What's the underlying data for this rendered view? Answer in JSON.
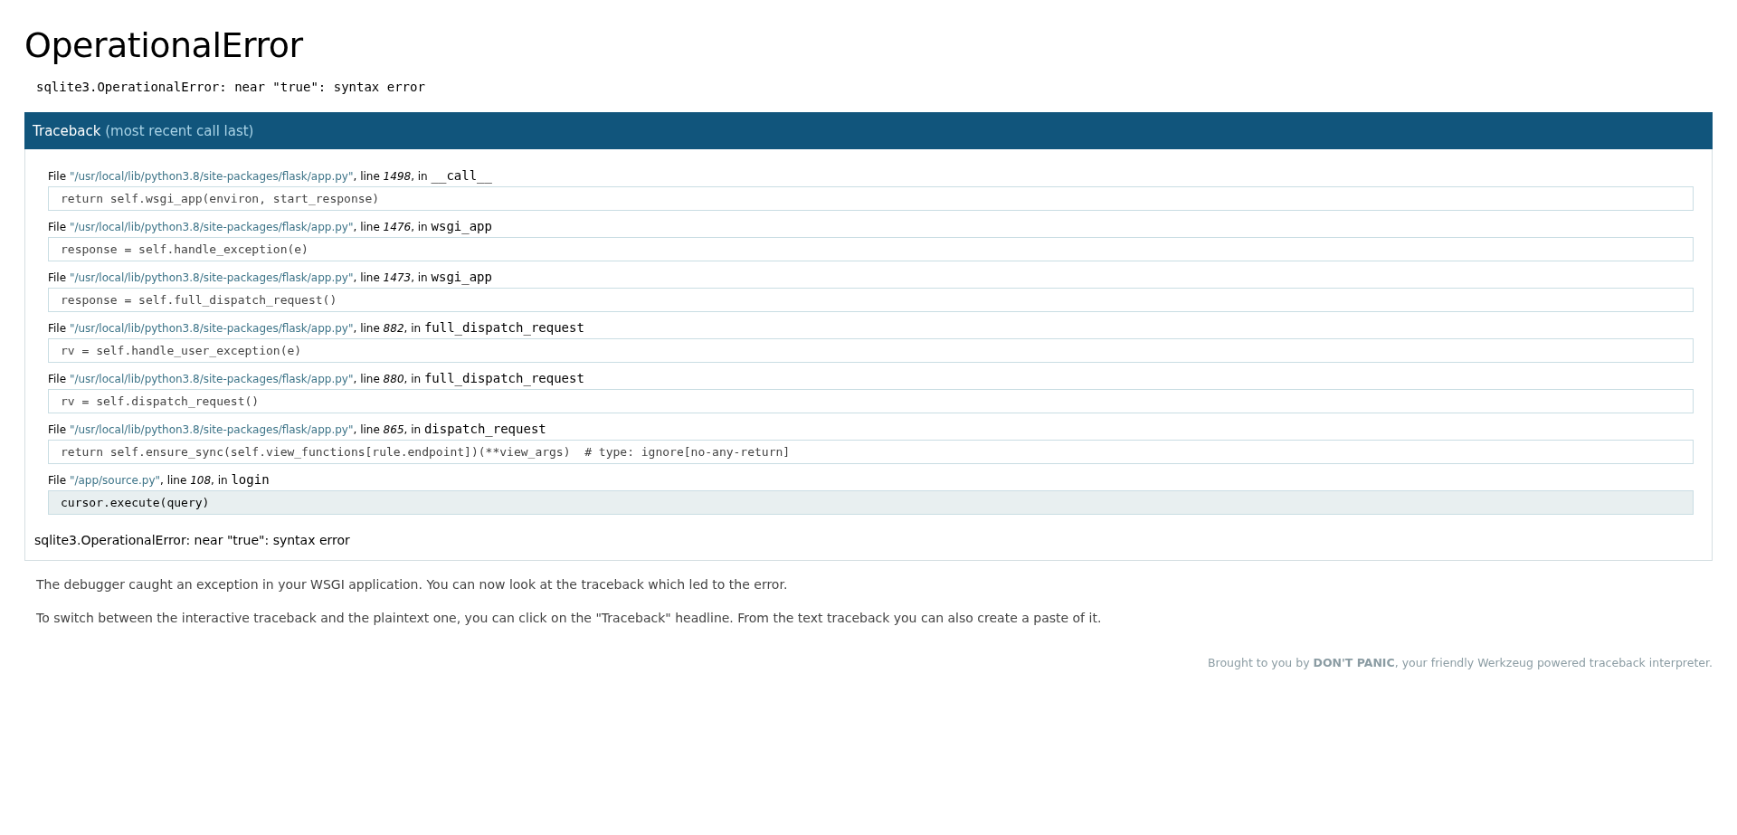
{
  "title": "OperationalError",
  "error_summary": "sqlite3.OperationalError: near \"true\": syntax error",
  "traceback": {
    "heading": "Traceback",
    "heading_note": "(most recent call last)",
    "frames": [
      {
        "file_label": "File ",
        "path": "\"/usr/local/lib/python3.8/site-packages/flask/app.py\"",
        "line_label": ", line ",
        "line": "1498",
        "in_label": ", in ",
        "function": "__call__",
        "code": "return self.wsgi_app(environ, start_response)",
        "current": false
      },
      {
        "file_label": "File ",
        "path": "\"/usr/local/lib/python3.8/site-packages/flask/app.py\"",
        "line_label": ", line ",
        "line": "1476",
        "in_label": ", in ",
        "function": "wsgi_app",
        "code": "response = self.handle_exception(e)",
        "current": false
      },
      {
        "file_label": "File ",
        "path": "\"/usr/local/lib/python3.8/site-packages/flask/app.py\"",
        "line_label": ", line ",
        "line": "1473",
        "in_label": ", in ",
        "function": "wsgi_app",
        "code": "response = self.full_dispatch_request()",
        "current": false
      },
      {
        "file_label": "File ",
        "path": "\"/usr/local/lib/python3.8/site-packages/flask/app.py\"",
        "line_label": ", line ",
        "line": "882",
        "in_label": ", in ",
        "function": "full_dispatch_request",
        "code": "rv = self.handle_user_exception(e)",
        "current": false
      },
      {
        "file_label": "File ",
        "path": "\"/usr/local/lib/python3.8/site-packages/flask/app.py\"",
        "line_label": ", line ",
        "line": "880",
        "in_label": ", in ",
        "function": "full_dispatch_request",
        "code": "rv = self.dispatch_request()",
        "current": false
      },
      {
        "file_label": "File ",
        "path": "\"/usr/local/lib/python3.8/site-packages/flask/app.py\"",
        "line_label": ", line ",
        "line": "865",
        "in_label": ", in ",
        "function": "dispatch_request",
        "code": "return self.ensure_sync(self.view_functions[rule.endpoint])(**view_args)  # type: ignore[no-any-return]",
        "current": false
      },
      {
        "file_label": "File ",
        "path": "\"/app/source.py\"",
        "line_label": ", line ",
        "line": "108",
        "in_label": ", in ",
        "function": "login",
        "code": "cursor.execute(query)",
        "current": true
      }
    ],
    "error_message": "sqlite3.OperationalError: near \"true\": syntax error"
  },
  "explanation": [
    "The debugger caught an exception in your WSGI application. You can now look at the traceback which led to the error.",
    "To switch between the interactive traceback and the plaintext one, you can click on the \"Traceback\" headline. From the text traceback you can also create a paste of it."
  ],
  "footer": "Brought to you by **DON'T PANIC**, your friendly Werkzeug powered traceback interpreter."
}
